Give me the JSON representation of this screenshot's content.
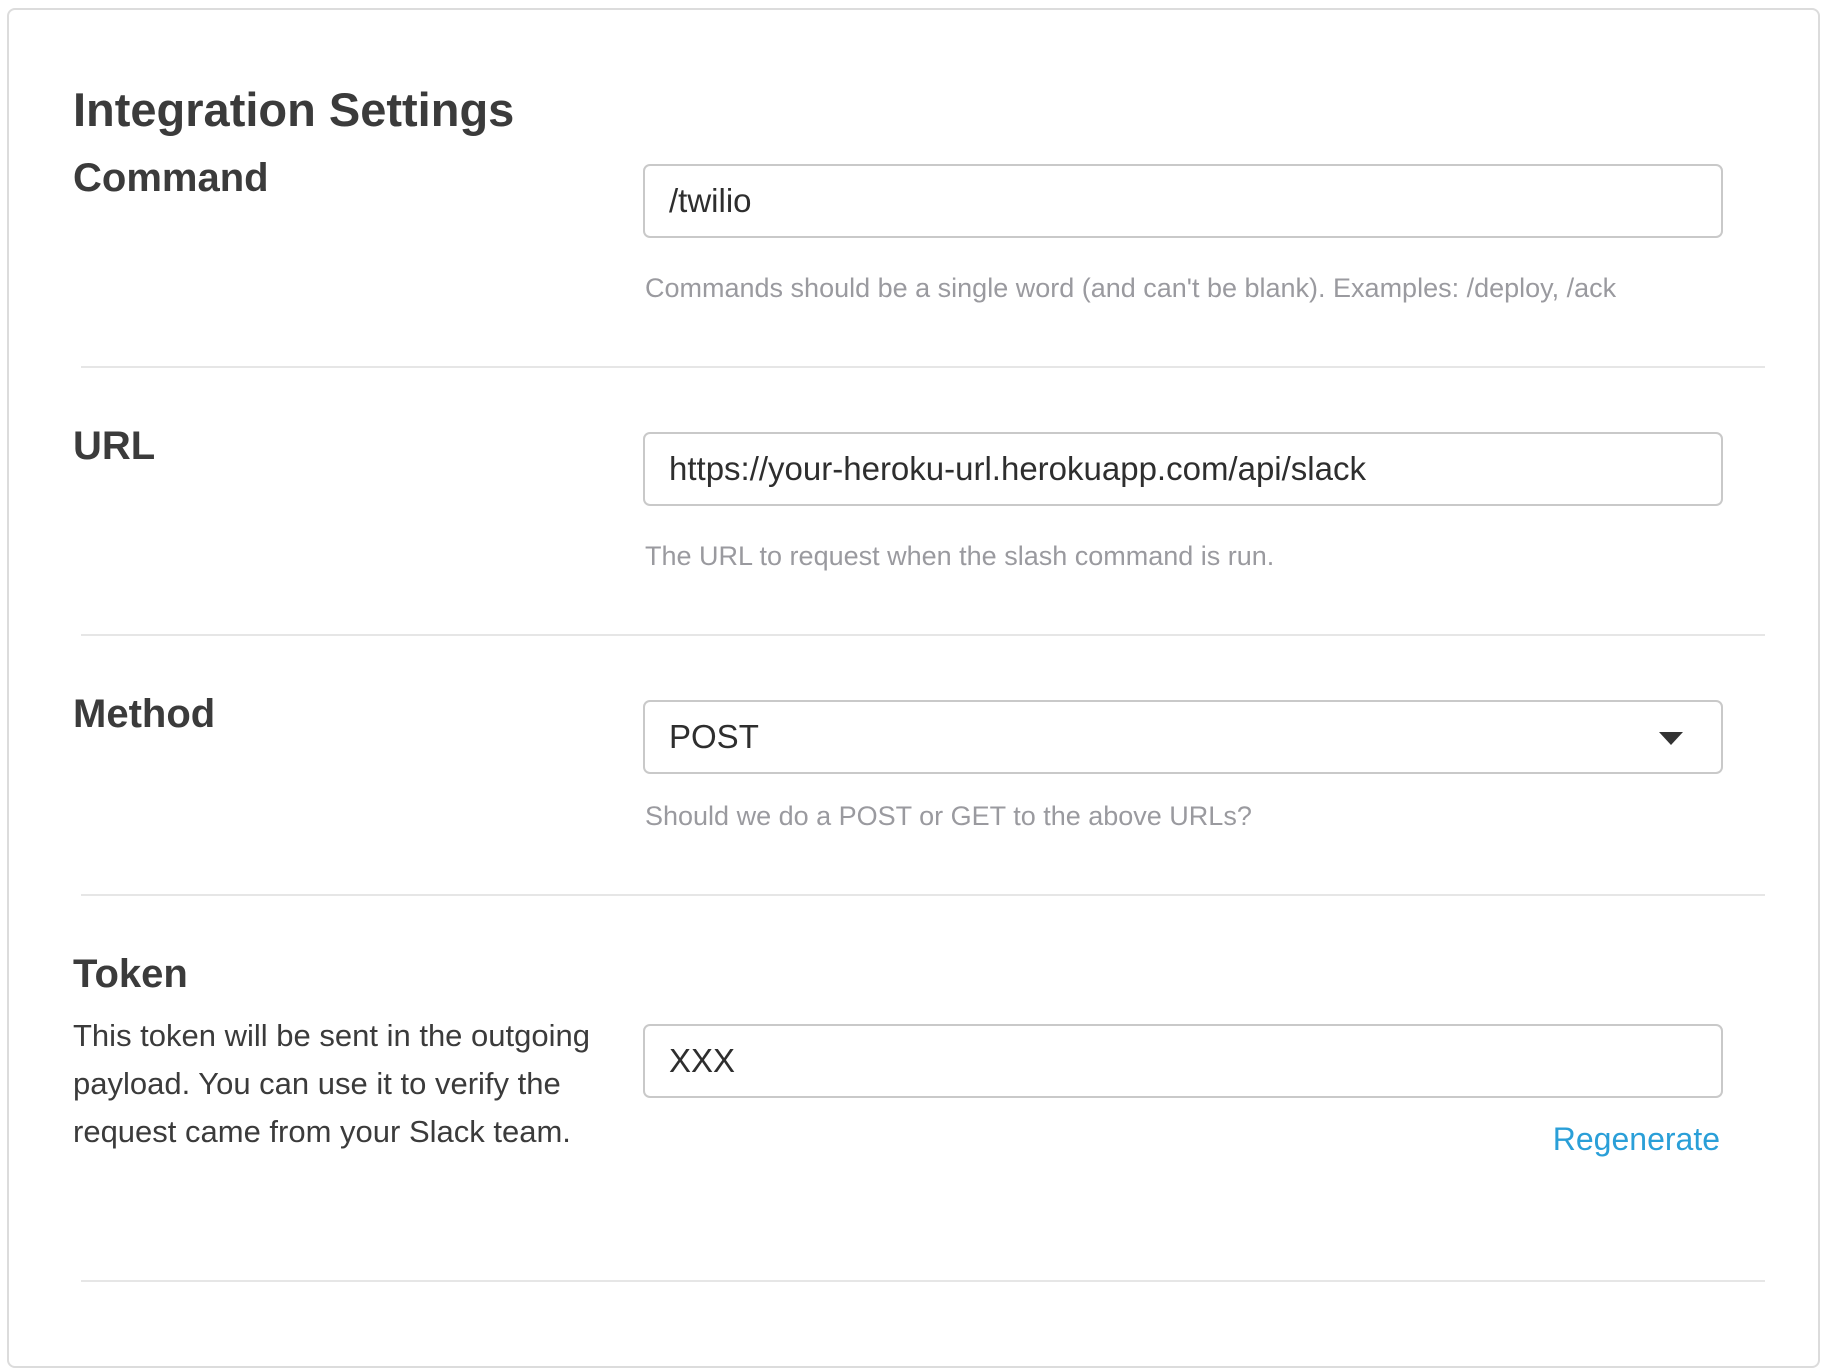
{
  "page": {
    "title": "Integration Settings"
  },
  "command": {
    "label": "Command",
    "value": "/twilio",
    "help": "Commands should be a single word (and can't be blank). Examples: /deploy, /ack"
  },
  "url": {
    "label": "URL",
    "value": "https://your-heroku-url.herokuapp.com/api/slack",
    "help": "The URL to request when the slash command is run."
  },
  "method": {
    "label": "Method",
    "selected": "POST",
    "help": "Should we do a POST or GET to the above URLs?",
    "dropdown_icon": "chevron-down-icon"
  },
  "token": {
    "label": "Token",
    "description": "This token will be sent in the outgoing payload. You can use it to verify the request came from your Slack team.",
    "value": "XXX",
    "regenerate_label": "Regenerate"
  },
  "colors": {
    "text": "#3b3b3b",
    "help_text": "#9a9a9f",
    "link": "#2a9fd8",
    "border": "#c9c9c9",
    "divider": "#e6e6e6"
  }
}
